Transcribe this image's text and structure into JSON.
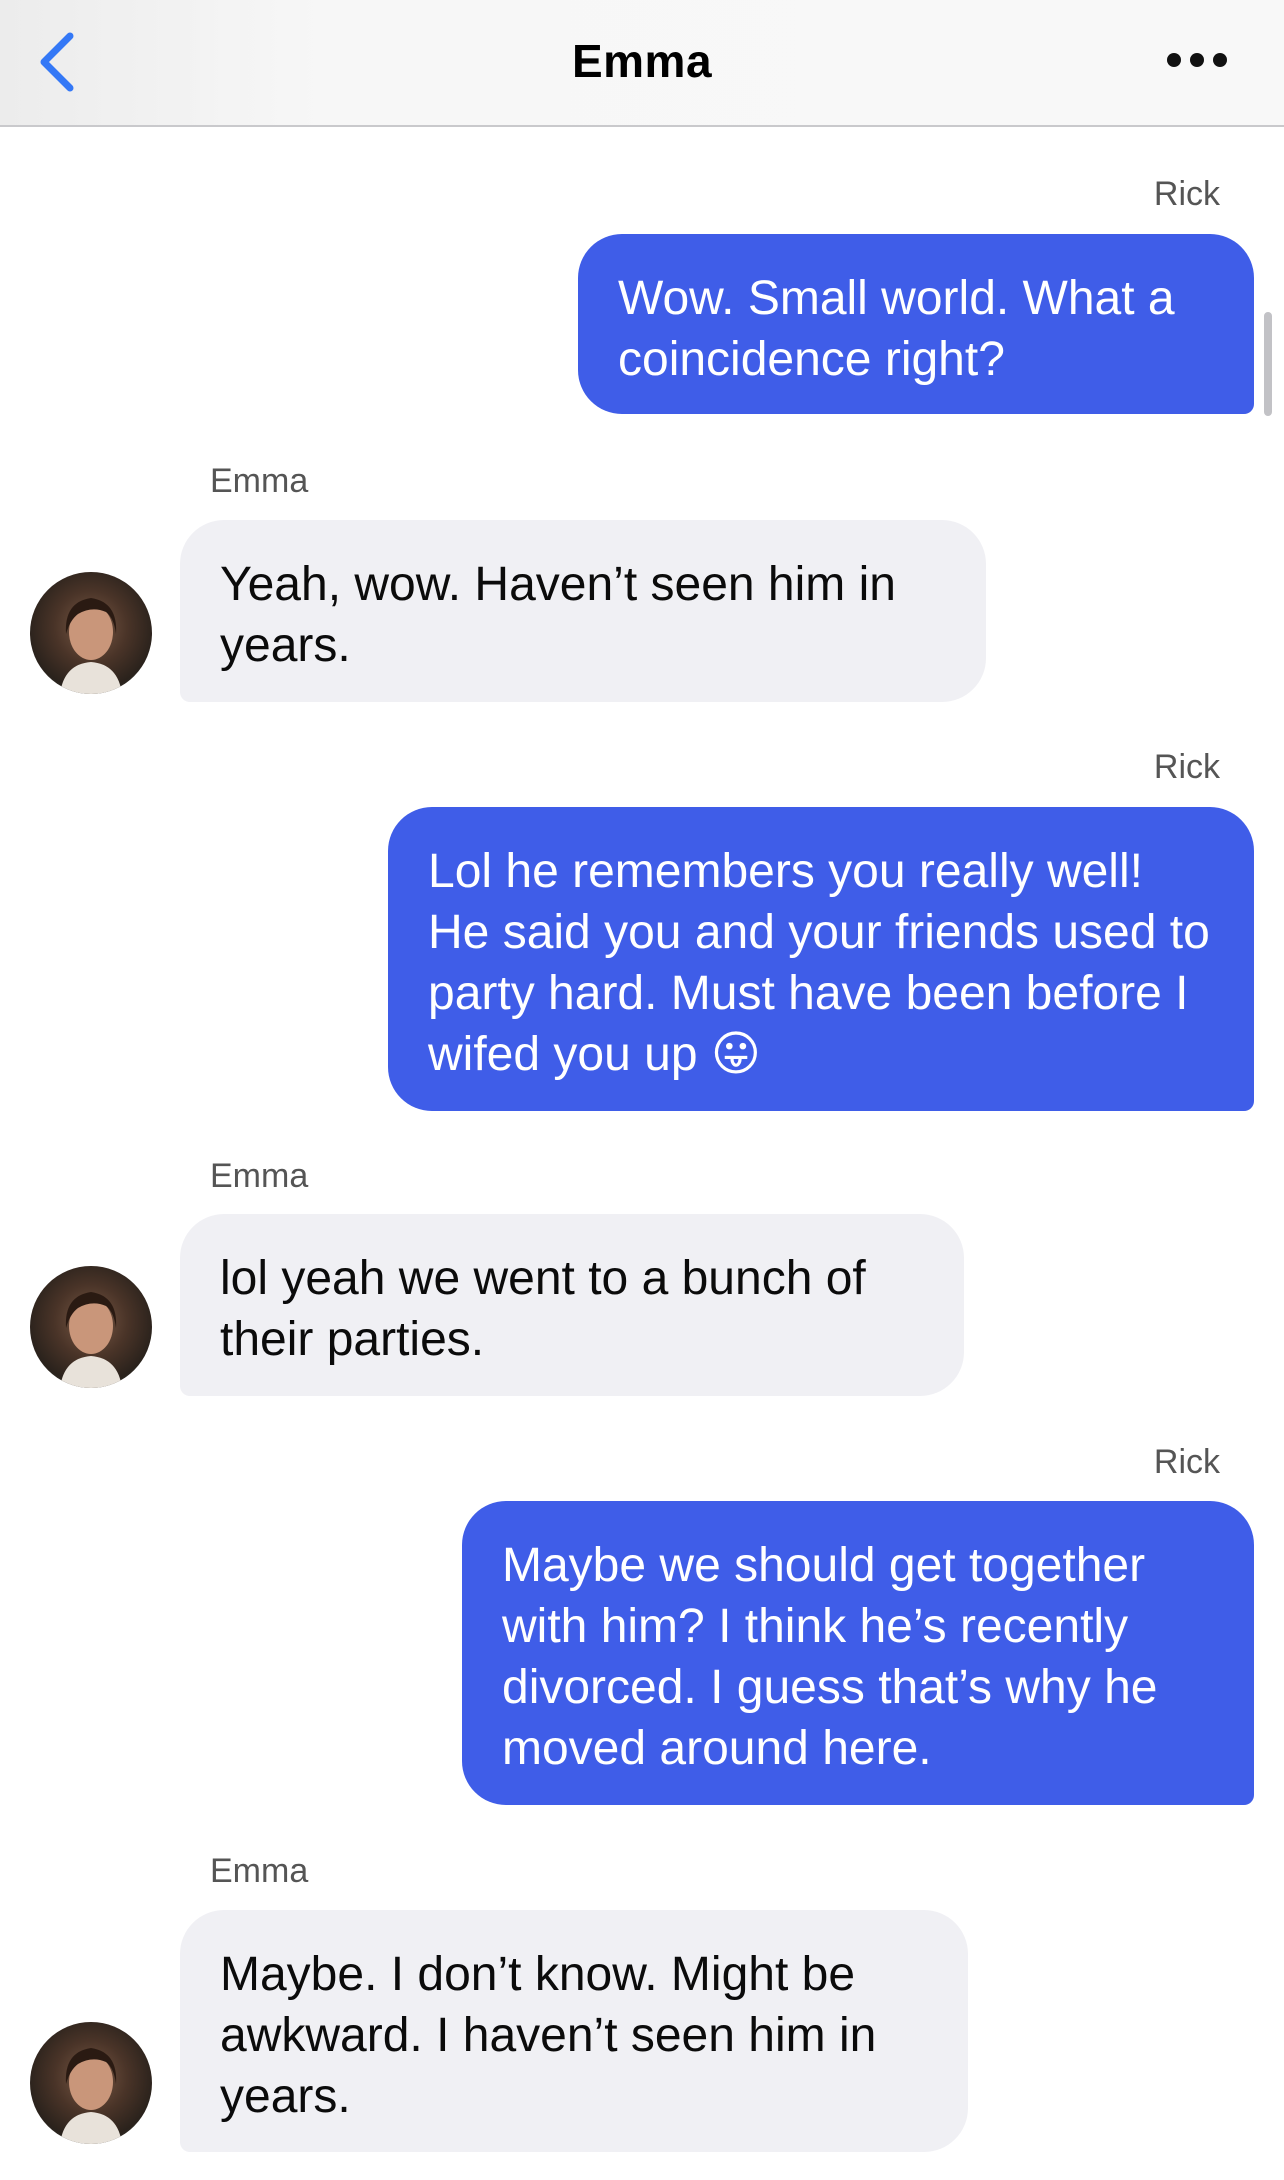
{
  "header": {
    "title": "Emma",
    "back_icon": "chevron-left-icon",
    "more_icon": "more-horizontal-icon",
    "accent_color": "#3478f6"
  },
  "colors": {
    "outgoing_bubble": "#3f5de8",
    "incoming_bubble": "#f0f0f4"
  },
  "messages": [
    {
      "sender": "Rick",
      "direction": "outgoing",
      "text": "Wow. Small world. What a coincidence right?"
    },
    {
      "sender": "Emma",
      "direction": "incoming",
      "text": "Yeah, wow. Haven’t seen him in years."
    },
    {
      "sender": "Rick",
      "direction": "outgoing",
      "text": "Lol he remembers you really well! He said you and your friends used to party hard. Must have been before I wifed you up 😛"
    },
    {
      "sender": "Emma",
      "direction": "incoming",
      "text": "lol yeah we went to a bunch of their parties."
    },
    {
      "sender": "Rick",
      "direction": "outgoing",
      "text": "Maybe we should get together with him? I think he’s recently divorced. I guess that’s why he moved around here."
    },
    {
      "sender": "Emma",
      "direction": "incoming",
      "text": "Maybe. I don’t know. Might be awkward. I haven’t seen him in years."
    }
  ]
}
